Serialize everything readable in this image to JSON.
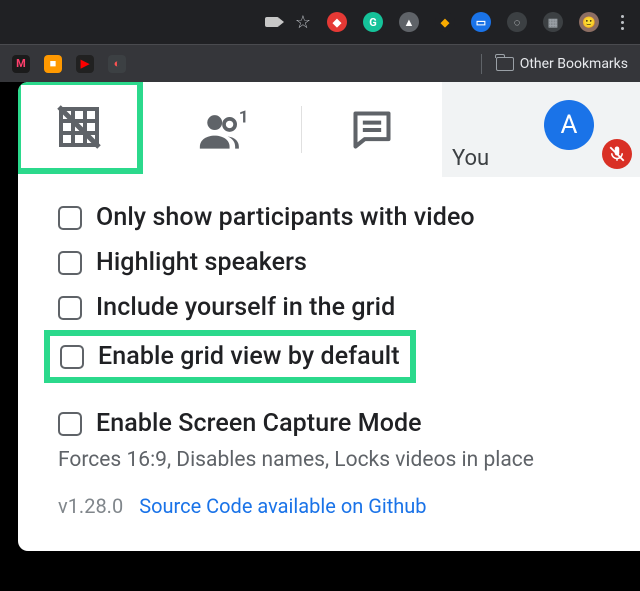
{
  "browser": {
    "extensions": [
      {
        "name": "adblock",
        "bg": "#e53935",
        "fg": "#fff",
        "glyph": "◆"
      },
      {
        "name": "grammarly",
        "bg": "#15c39a",
        "fg": "#fff",
        "glyph": "G"
      },
      {
        "name": "drive",
        "bg": "#5f6368",
        "fg": "#fff",
        "glyph": "▲"
      },
      {
        "name": "superman",
        "bg": "#202124",
        "fg": "#f9ab00",
        "glyph": "◆"
      },
      {
        "name": "docs",
        "bg": "#1a73e8",
        "fg": "#fff",
        "glyph": "▭"
      },
      {
        "name": "lightbulb",
        "bg": "#3c4043",
        "fg": "#e8eaed",
        "glyph": "◌"
      },
      {
        "name": "grid",
        "bg": "#3c4043",
        "fg": "#9aa0a6",
        "glyph": "▦"
      },
      {
        "name": "avatar",
        "bg": "#8d6e63",
        "fg": "#fff",
        "glyph": "🙂"
      }
    ],
    "bookmarks": [
      {
        "name": "myntra",
        "bg": "#1b1b1b",
        "fg": "#ff3f6c",
        "glyph": "M"
      },
      {
        "name": "amazon",
        "bg": "#ff9900",
        "fg": "#fff",
        "glyph": "■"
      },
      {
        "name": "youtube",
        "bg": "#212121",
        "fg": "#ff0000",
        "glyph": "▶"
      },
      {
        "name": "other",
        "bg": "#3c4043",
        "fg": "#ff5252",
        "glyph": "◐"
      }
    ],
    "other_bookmarks_label": "Other Bookmarks"
  },
  "meet": {
    "you_label": "You",
    "avatar_initial": "A"
  },
  "options": [
    {
      "key": "only_video",
      "label": "Only show participants with video"
    },
    {
      "key": "highlight_speakers",
      "label": "Highlight speakers"
    },
    {
      "key": "include_self",
      "label": "Include yourself in the grid"
    },
    {
      "key": "enable_default",
      "label": "Enable grid view by default"
    }
  ],
  "screen_capture": {
    "label": "Enable Screen Capture Mode",
    "desc": "Forces 16:9, Disables names, Locks videos in place"
  },
  "footer": {
    "version": "v1.28.0",
    "link": "Source Code available on Github"
  }
}
